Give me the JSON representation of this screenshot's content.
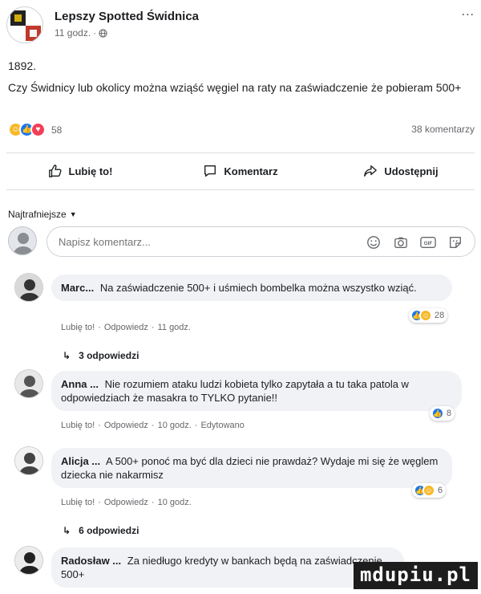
{
  "post": {
    "page_name": "Lepszy Spotted Świdnica",
    "time": "11 godz.",
    "visibility_icon": "globe-icon",
    "more_icon": "more-dots-icon",
    "more_label": "...",
    "number": "1892.",
    "text": "Czy Świdnicy lub okolicy można wziąść węgiel na raty na zaświadczenie że pobieram 500+",
    "reactions": [
      "haha",
      "like",
      "love"
    ],
    "reaction_count": "58",
    "comment_count": "38 komentarzy"
  },
  "actions": {
    "like_label": "Lubię to!",
    "comment_label": "Komentarz",
    "share_label": "Udostępnij"
  },
  "comments_filter": "Najtrafniejsze",
  "composer": {
    "placeholder": "Napisz komentarz..."
  },
  "comments": [
    {
      "author": "Marc...",
      "text": "Na zaświadczenie 500+ i uśmiech bombelka można wszystko wziąć.",
      "meta": [
        "Lubię to!",
        "Odpowiedz",
        "11 godz."
      ],
      "reactions": [
        "like",
        "haha"
      ],
      "reaction_count": "28",
      "replies": "3 odpowiedzi"
    },
    {
      "author": "Anna ...",
      "text": "Nie rozumiem ataku ludzi kobieta tylko zapytała a tu taka patola w odpowiedziach że masakra to TYLKO pytanie!!",
      "meta": [
        "Lubię to!",
        "Odpowiedz",
        "10 godz.",
        "Edytowano"
      ],
      "reactions": [
        "like"
      ],
      "reaction_count": "8"
    },
    {
      "author": "Alicja ...",
      "text": "A 500+ ponoć ma być dla dzieci nie prawdaż? Wydaje mi się że węglem dziecka nie nakarmisz",
      "meta": [
        "Lubię to!",
        "Odpowiedz",
        "10 godz."
      ],
      "reactions": [
        "like",
        "haha"
      ],
      "reaction_count": "6",
      "replies": "6 odpowiedzi"
    },
    {
      "author": "Radosław ...",
      "text": "Za niedługo kredyty w bankach będą na zaświadczenie 500+"
    }
  ],
  "watermark": "mdupiu.pl"
}
